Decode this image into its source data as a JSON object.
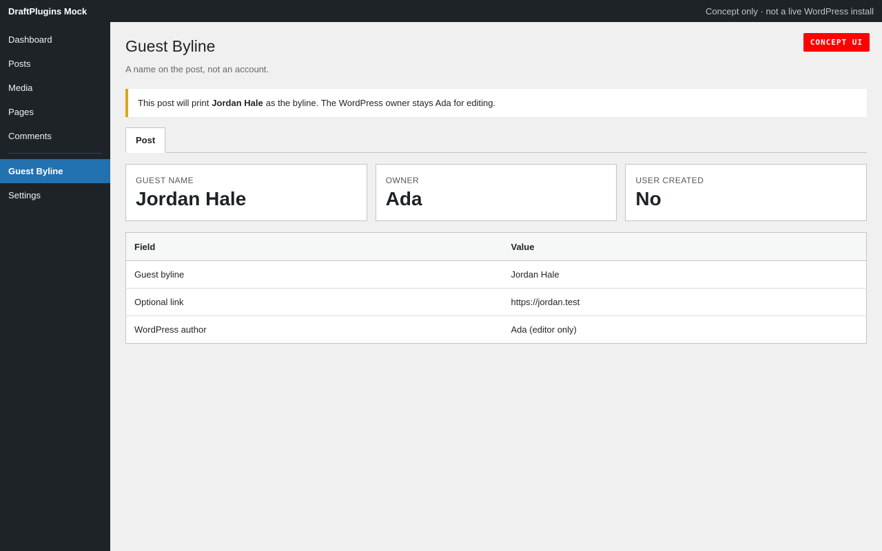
{
  "topbar": {
    "brand": "DraftPlugins Mock",
    "note": "Concept only · not a live WordPress install"
  },
  "sidebar": {
    "items": [
      {
        "label": "Dashboard"
      },
      {
        "label": "Posts"
      },
      {
        "label": "Media"
      },
      {
        "label": "Pages"
      },
      {
        "label": "Comments"
      },
      {
        "label": "Guest Byline",
        "active": true
      },
      {
        "label": "Settings"
      }
    ]
  },
  "page": {
    "title": "Guest Byline",
    "subtitle": "A name on the post, not an account.",
    "badge": "CONCEPT UI"
  },
  "notice": {
    "prefix": "This post will print",
    "name": "Jordan Hale",
    "suffix": "as the byline. The WordPress owner stays Ada for editing."
  },
  "tabs": [
    {
      "label": "Post",
      "active": true
    }
  ],
  "cards": [
    {
      "label": "GUEST NAME",
      "value": "Jordan Hale"
    },
    {
      "label": "OWNER",
      "value": "Ada"
    },
    {
      "label": "USER CREATED",
      "value": "No"
    }
  ],
  "table": {
    "headers": [
      "Field",
      "Value"
    ],
    "rows": [
      [
        "Guest byline",
        "Jordan Hale"
      ],
      [
        "Optional link",
        "https://jordan.test"
      ],
      [
        "WordPress author",
        "Ada (editor only)"
      ]
    ]
  },
  "colors": {
    "admin_bar": "#1d2327",
    "active_menu": "#2271b1",
    "notice_border": "#dba617",
    "badge": "#ff0000"
  }
}
